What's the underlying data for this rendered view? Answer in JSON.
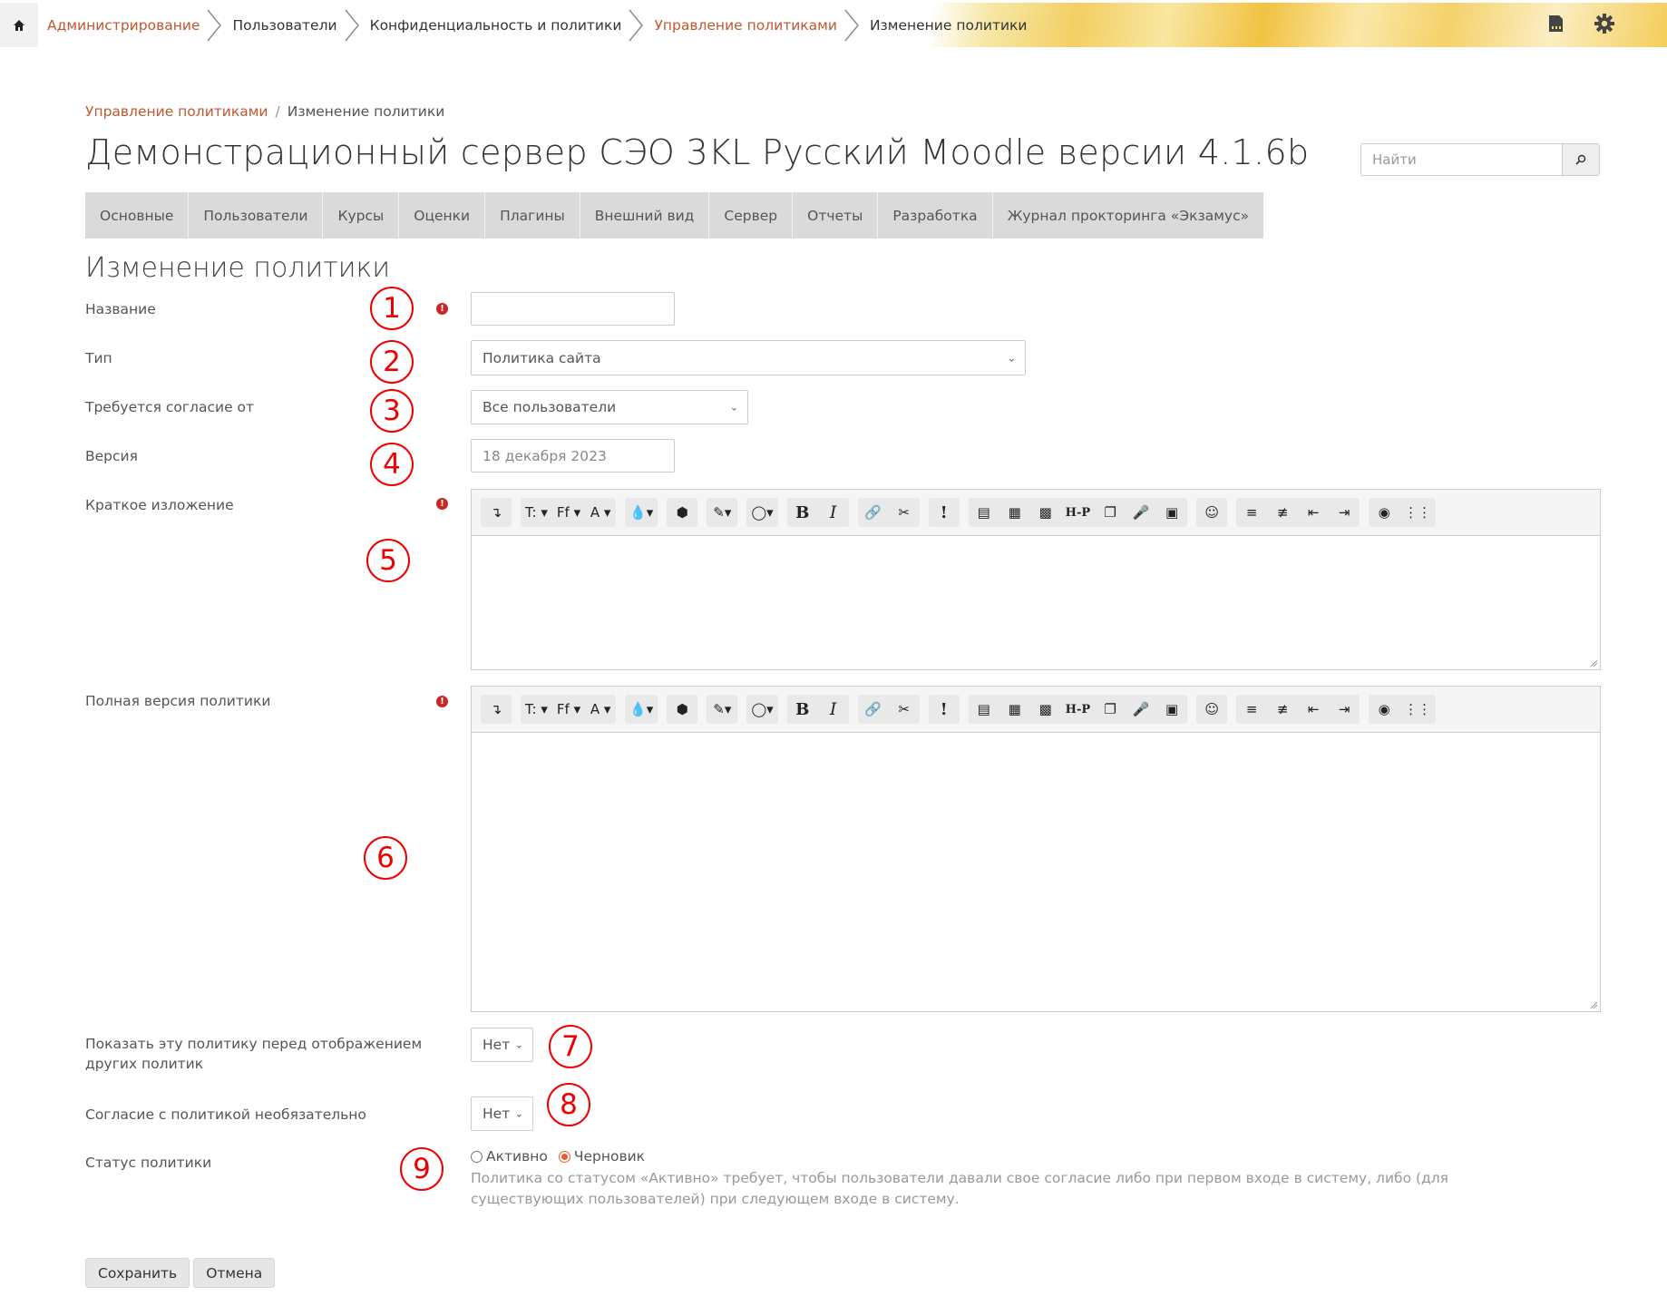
{
  "topbar": {
    "home_icon": "home-icon",
    "crumbs": [
      {
        "label": "Администрирование",
        "link": true
      },
      {
        "label": "Пользователи",
        "link": false
      },
      {
        "label": "Конфиденциальность и политики",
        "link": false
      },
      {
        "label": "Управление политиками",
        "link": true
      },
      {
        "label": "Изменение политики",
        "link": false
      }
    ],
    "icons": [
      "sd-card-icon",
      "gear-icon"
    ]
  },
  "breadcrumb": {
    "link": "Управление политиками",
    "current": "Изменение политики"
  },
  "page_title": "Демонстрационный сервер СЭО 3KL Русский Moodle версии 4.1.6b",
  "search": {
    "placeholder": "Найти"
  },
  "nav_tabs": [
    "Основные",
    "Пользователи",
    "Курсы",
    "Оценки",
    "Плагины",
    "Внешний вид",
    "Сервер",
    "Отчеты",
    "Разработка",
    "Журнал прокторинга «Экзамус»"
  ],
  "section_title": "Изменение политики",
  "form": {
    "name_label": "Название",
    "name_value": "",
    "type_label": "Тип",
    "type_value": "Политика сайта",
    "consent_label": "Требуется согласие от",
    "consent_value": "Все пользователи",
    "version_label": "Версия",
    "version_placeholder": "18 декабря 2023",
    "summary_label": "Краткое изложение",
    "full_label": "Полная версия политики",
    "show_before_label": "Показать эту политику перед отображением других политик",
    "show_before_value": "Нет",
    "optional_label": "Согласие с политикой необязательно",
    "optional_value": "Нет",
    "status_label": "Статус политики",
    "status_options": [
      "Активно",
      "Черновик"
    ],
    "status_selected": "Черновик",
    "status_help": "Политика со статусом «Активно» требует, чтобы пользователи давали свое согласие либо при первом входе в систему, либо (для существующих пользователей) при следующем входе в систему."
  },
  "markers": [
    "1",
    "2",
    "3",
    "4",
    "5",
    "6",
    "7",
    "8",
    "9"
  ],
  "toolbar": {
    "undo": "↴",
    "text_size": "T:",
    "font": "Ff",
    "font_color": "A",
    "bold": "B",
    "italic": "I",
    "hp": "H-P",
    "exclaim": "!"
  },
  "buttons": {
    "save": "Сохранить",
    "cancel": "Отмена"
  },
  "colors": {
    "link": "#c0582f",
    "required": "#c62828",
    "marker": "#e00000",
    "radio_on": "#e65c2e"
  }
}
